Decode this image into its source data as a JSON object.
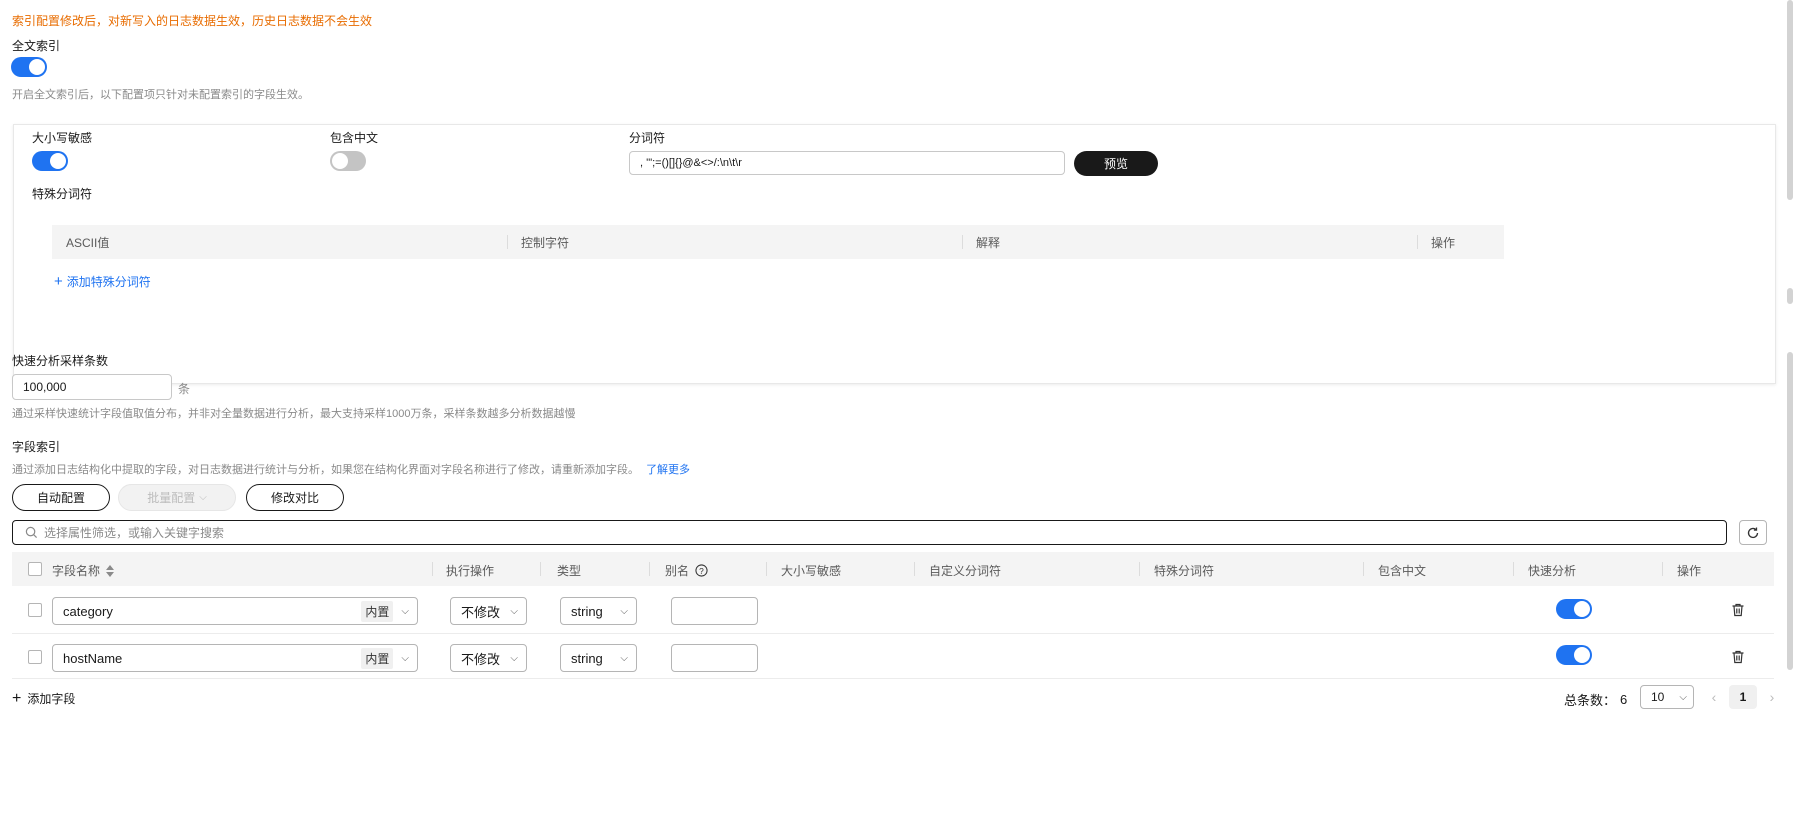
{
  "notice": "索引配置修改后，对新写入的日志数据生效，历史日志数据不会生效",
  "full_text_index": {
    "label": "全文索引",
    "enabled": true,
    "hint": "开启全文索引后，以下配置项只针对未配置索引的字段生效。"
  },
  "panel": {
    "case_sensitive_label": "大小写敏感",
    "case_sensitive": true,
    "include_chinese_label": "包含中文",
    "include_chinese": false,
    "delimiter_label": "分词符",
    "delimiter_value": ", '\";=()[]{}@&<>/:\\n\\t\\r",
    "preview_button": "预览",
    "special_delimiter_label": "特殊分词符",
    "special_table_headers": [
      "ASCII值",
      "控制字符",
      "解释",
      "操作"
    ],
    "add_special_delimiter": "添加特殊分词符"
  },
  "sampling": {
    "label": "快速分析采样条数",
    "value": "100,000",
    "unit": "条",
    "hint": "通过采样快速统计字段值取值分布，并非对全量数据进行分析，最大支持采样1000万条，采样条数越多分析数据越慢"
  },
  "field_index": {
    "label": "字段索引",
    "hint": "通过添加日志结构化中提取的字段，对日志数据进行统计与分析，如果您在结构化界面对字段名称进行了修改，请重新添加字段。",
    "learn_more": "了解更多",
    "auto_config": "自动配置",
    "batch_config": "批量配置",
    "compare": "修改对比",
    "search_placeholder": "选择属性筛选，或输入关键字搜索",
    "columns": [
      "字段名称",
      "执行操作",
      "类型",
      "别名",
      "大小写敏感",
      "自定义分词符",
      "特殊分词符",
      "包含中文",
      "快速分析",
      "操作"
    ],
    "rows": [
      {
        "name": "category",
        "tag": "内置",
        "action": "不修改",
        "type": "string",
        "alias": "",
        "quick_analysis": true
      },
      {
        "name": "hostName",
        "tag": "内置",
        "action": "不修改",
        "type": "string",
        "alias": "",
        "quick_analysis": true
      }
    ],
    "add_field": "添加字段"
  },
  "pagination": {
    "total_label": "总条数：",
    "total": "6",
    "page_size": "10",
    "current_page": "1"
  },
  "colors": {
    "accent": "#1f73f1",
    "notice": "#e86c00",
    "dark_button": "#191919"
  }
}
